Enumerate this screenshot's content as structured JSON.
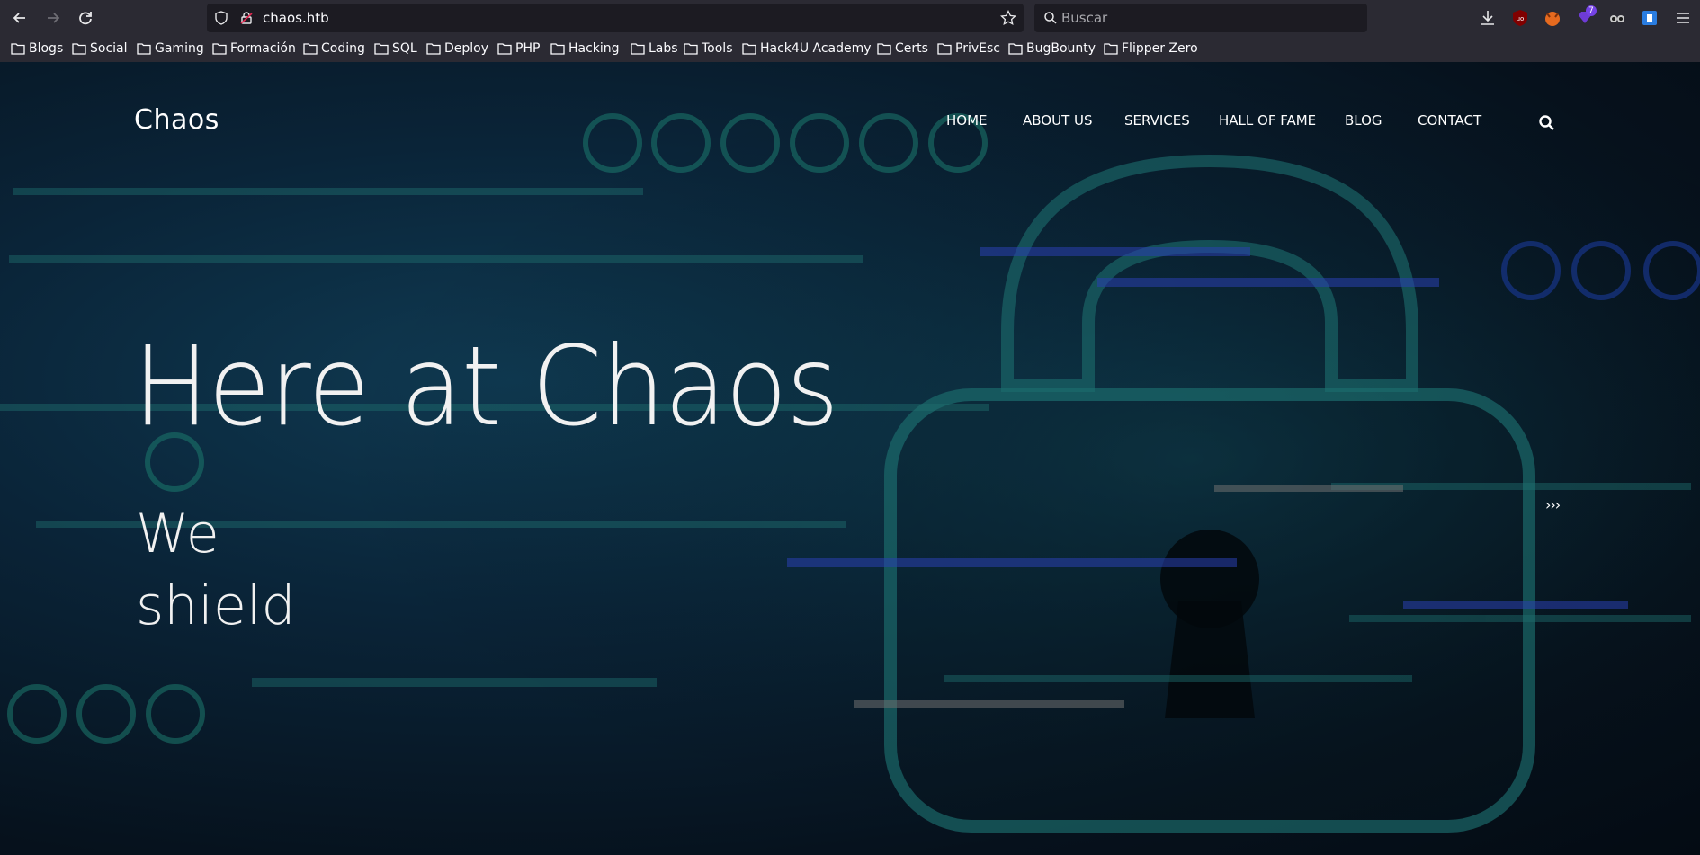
{
  "browser": {
    "url": "chaos.htb",
    "search_placeholder": "Buscar",
    "extension_badge": "7",
    "bookmarks": [
      "Blogs",
      "Social",
      "Gaming",
      "Formación",
      "Coding",
      "SQL",
      "Deploy",
      "PHP",
      "Hacking",
      "Labs",
      "Tools",
      "Hack4U Academy",
      "Certs",
      "PrivEsc",
      "BugBounty",
      "Flipper Zero"
    ]
  },
  "site": {
    "brand": "Chaos",
    "nav": [
      "HOME",
      "ABOUT US",
      "SERVICES",
      "HALL OF FAME",
      "BLOG",
      "CONTACT"
    ],
    "hero_title": "Here at Chaos",
    "hero_line1": "We",
    "hero_line2": "shield",
    "slider_next": "›››"
  },
  "colors": {
    "chrome_bg": "#2b2a33",
    "field_bg": "#1c1b22",
    "page_teal": "#1e6b6b",
    "text": "#ffffff"
  }
}
